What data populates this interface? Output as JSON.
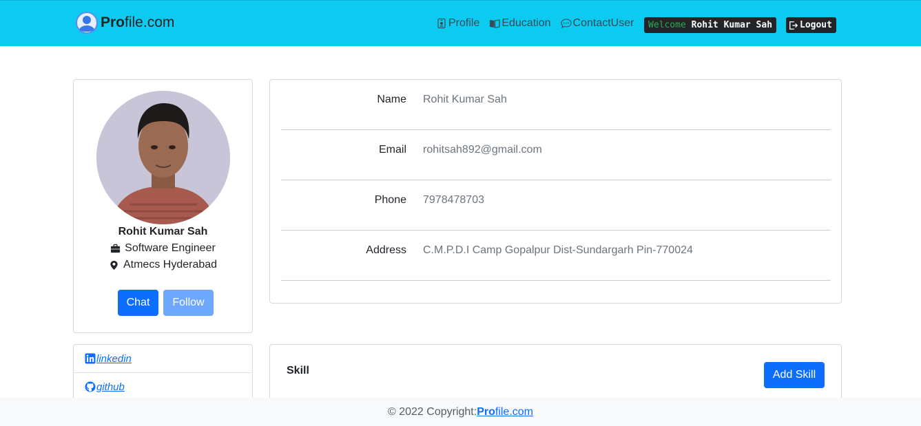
{
  "navbar": {
    "brand_bold": "Pro",
    "brand_rest": "file.com",
    "links": [
      {
        "label": "Profile",
        "icon": "person-badge-icon"
      },
      {
        "label": " Education",
        "icon": "book-icon"
      },
      {
        "label": "ContactUser",
        "icon": "chat-dots-icon"
      }
    ],
    "welcome_label": "Welcome ",
    "welcome_name": "Rohit Kumar Sah",
    "logout_label": "Logout"
  },
  "profile": {
    "name": "Rohit Kumar Sah",
    "role": "Software Engineer",
    "location": "Atmecs Hyderabad",
    "chat_label": "Chat",
    "follow_label": "Follow"
  },
  "details": [
    {
      "label": "Name",
      "value": "Rohit Kumar Sah"
    },
    {
      "label": "Email",
      "value": "rohitsah892@gmail.com"
    },
    {
      "label": "Phone",
      "value": "7978478703"
    },
    {
      "label": "Address",
      "value": "C.M.P.D.I Camp Gopalpur Dist-Sundargarh Pin-770024"
    }
  ],
  "social": [
    {
      "label": "linkedin",
      "icon": "linkedin-icon"
    },
    {
      "label": "github",
      "icon": "github-icon"
    }
  ],
  "skill": {
    "title": "Skill",
    "add_label": "Add Skill"
  },
  "footer": {
    "copyright": "© 2022 Copyright:",
    "brand_bold": "Pro",
    "brand_rest": "file.com"
  },
  "colors": {
    "navbar_bg": "#0dcaf0",
    "primary": "#0d6efd",
    "dark": "#212529"
  }
}
